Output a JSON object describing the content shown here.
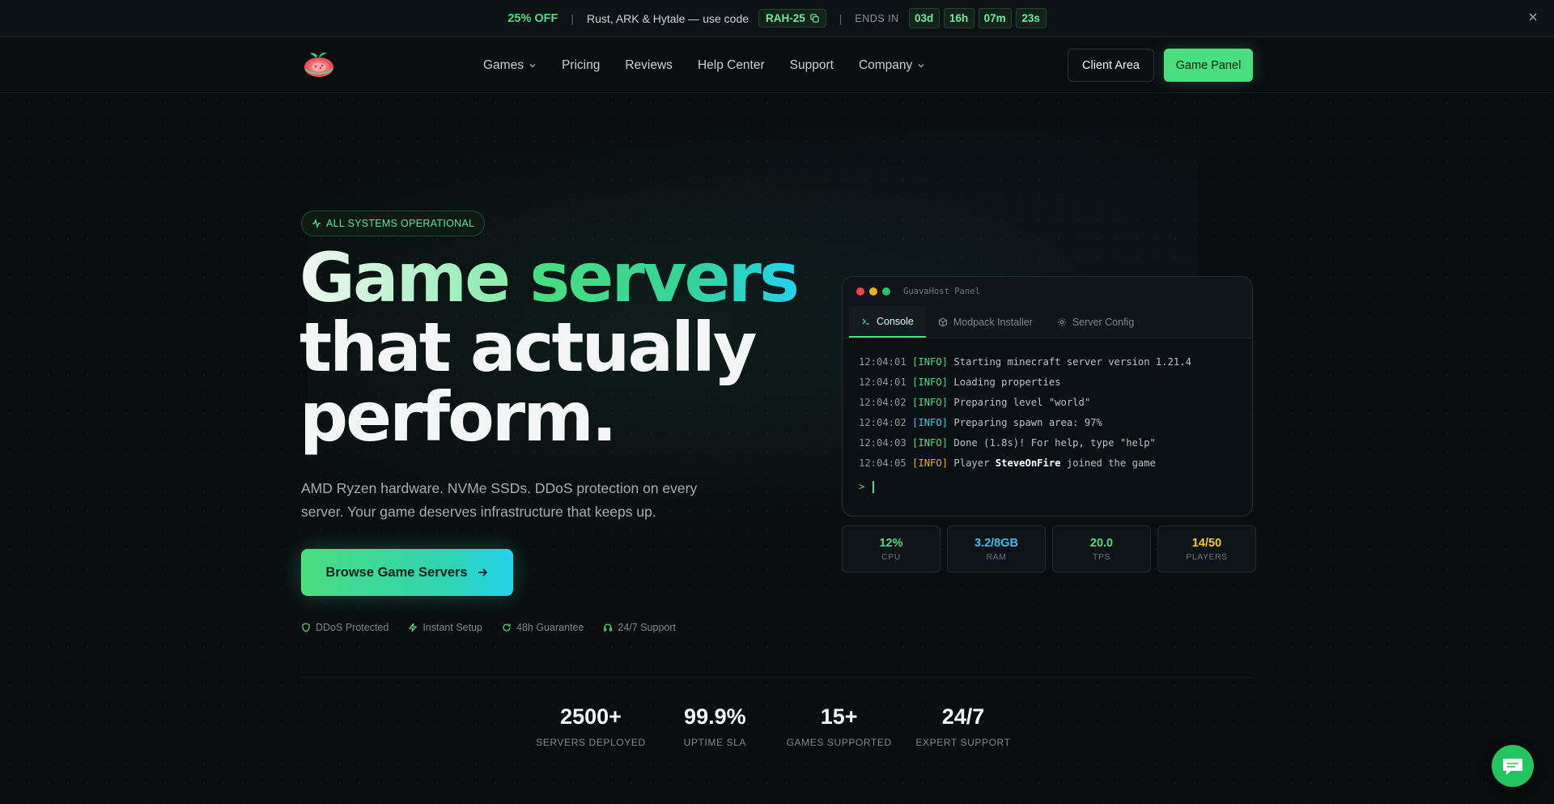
{
  "promo": {
    "discount": "25% OFF",
    "separator": "|",
    "message": "Rust, ARK & Hytale — use code",
    "code": "RAH-25",
    "ends_label": "ENDS IN",
    "countdown": [
      "03d",
      "16h",
      "07m",
      "23s"
    ]
  },
  "nav": {
    "items": [
      {
        "label": "Games",
        "dropdown": true
      },
      {
        "label": "Pricing",
        "dropdown": false
      },
      {
        "label": "Reviews",
        "dropdown": false
      },
      {
        "label": "Help Center",
        "dropdown": false
      },
      {
        "label": "Support",
        "dropdown": false
      },
      {
        "label": "Company",
        "dropdown": true
      }
    ],
    "client_area": "Client Area",
    "game_panel": "Game Panel"
  },
  "hero": {
    "badge": "ALL SYSTEMS OPERATIONAL",
    "headline_1a": "Game",
    "headline_1b": "servers",
    "headline_2": "that actually",
    "headline_3": "perform.",
    "subtitle": "AMD Ryzen hardware. NVMe SSDs. DDoS protection on every server. Your game deserves infrastructure that keeps up.",
    "cta": "Browse Game Servers",
    "features": [
      "DDoS Protected",
      "Instant Setup",
      "48h Guarantee",
      "24/7 Support"
    ]
  },
  "terminal": {
    "title": "GuavaHost Panel",
    "tabs": [
      "Console",
      "Modpack Installer",
      "Server Config"
    ],
    "active_tab": "Console",
    "log": [
      {
        "time": "12:04:01",
        "tag": "[INFO]",
        "pre": "Starting minecraft server version 1.21.4",
        "bold": "",
        "post": ""
      },
      {
        "time": "12:04:01",
        "tag": "[INFO]",
        "pre": "Loading properties",
        "bold": "",
        "post": ""
      },
      {
        "time": "12:04:02",
        "tag": "[INFO]",
        "pre": "Preparing level \"world\"",
        "bold": "",
        "post": ""
      },
      {
        "time": "12:04:02",
        "tag": "[INFO]",
        "pre": "Preparing spawn area: 97%",
        "bold": "",
        "post": ""
      },
      {
        "time": "12:04:03",
        "tag": "[INFO]",
        "pre": "Done (1.8s)! For help, type \"help\"",
        "bold": "",
        "post": ""
      },
      {
        "time": "12:04:05",
        "tag": "[INFO]",
        "pre": "Player ",
        "bold": "SteveOnFire",
        "post": " joined the game"
      }
    ],
    "prompt": ">"
  },
  "stats": [
    {
      "value": "12%",
      "label": "CPU",
      "color": "#4ade80"
    },
    {
      "value": "3.2/8GB",
      "label": "RAM",
      "color": "#38bdf8"
    },
    {
      "value": "20.0",
      "label": "TPS",
      "color": "#4ade80"
    },
    {
      "value": "14/50",
      "label": "PLAYERS",
      "color": "#facc15"
    }
  ],
  "bottom_stats": [
    {
      "value": "2500+",
      "label": "SERVERS DEPLOYED"
    },
    {
      "value": "99.9%",
      "label": "UPTIME SLA"
    },
    {
      "value": "15+",
      "label": "GAMES SUPPORTED"
    },
    {
      "value": "24/7",
      "label": "EXPERT SUPPORT"
    }
  ],
  "colors": {
    "accent": "#4ade80",
    "accent_cyan": "#22d3ee",
    "background": "#0a0d10"
  }
}
